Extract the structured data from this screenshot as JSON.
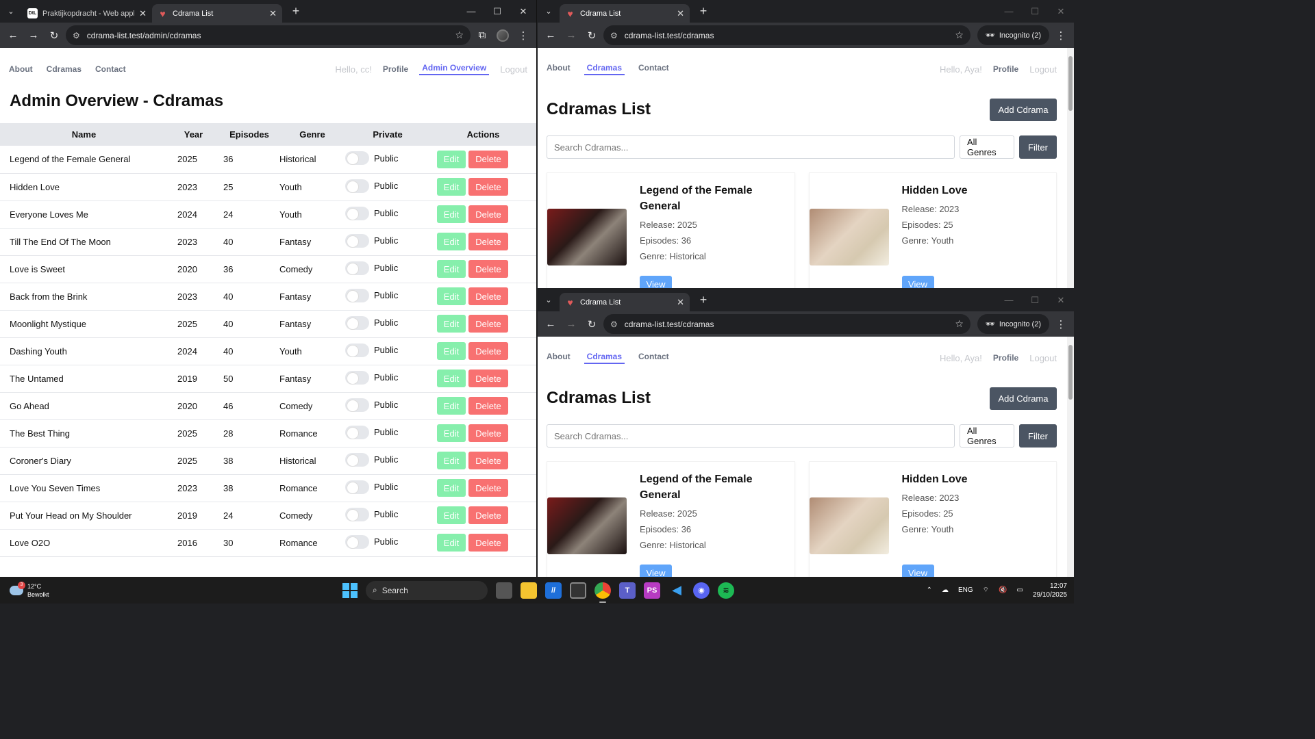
{
  "left_window": {
    "tabs": [
      {
        "title": "Praktijkopdracht - Web applicat",
        "favicon": "DtL"
      },
      {
        "title": "Cdrama List",
        "favicon": "heart-logo"
      }
    ],
    "url": "cdrama-list.test/admin/cdramas",
    "nav": {
      "links": [
        "About",
        "Cdramas",
        "Contact"
      ],
      "greeting": "Hello, cc!",
      "profile": "Profile",
      "active": "Admin Overview",
      "logout": "Logout"
    },
    "title": "Admin Overview - Cdramas",
    "columns": [
      "Name",
      "Year",
      "Episodes",
      "Genre",
      "Private",
      "Actions"
    ],
    "rows": [
      {
        "name": "Legend of the Female General",
        "year": "2025",
        "episodes": "36",
        "genre": "Historical",
        "private": "Public"
      },
      {
        "name": "Hidden Love",
        "year": "2023",
        "episodes": "25",
        "genre": "Youth",
        "private": "Public"
      },
      {
        "name": "Everyone Loves Me",
        "year": "2024",
        "episodes": "24",
        "genre": "Youth",
        "private": "Public"
      },
      {
        "name": "Till The End Of The Moon",
        "year": "2023",
        "episodes": "40",
        "genre": "Fantasy",
        "private": "Public"
      },
      {
        "name": "Love is Sweet",
        "year": "2020",
        "episodes": "36",
        "genre": "Comedy",
        "private": "Public"
      },
      {
        "name": "Back from the Brink",
        "year": "2023",
        "episodes": "40",
        "genre": "Fantasy",
        "private": "Public"
      },
      {
        "name": "Moonlight Mystique",
        "year": "2025",
        "episodes": "40",
        "genre": "Fantasy",
        "private": "Public"
      },
      {
        "name": "Dashing Youth",
        "year": "2024",
        "episodes": "40",
        "genre": "Youth",
        "private": "Public"
      },
      {
        "name": "The Untamed",
        "year": "2019",
        "episodes": "50",
        "genre": "Fantasy",
        "private": "Public"
      },
      {
        "name": "Go Ahead",
        "year": "2020",
        "episodes": "46",
        "genre": "Comedy",
        "private": "Public"
      },
      {
        "name": "The Best Thing",
        "year": "2025",
        "episodes": "28",
        "genre": "Romance",
        "private": "Public"
      },
      {
        "name": "Coroner's Diary",
        "year": "2025",
        "episodes": "38",
        "genre": "Historical",
        "private": "Public"
      },
      {
        "name": "Love You Seven Times",
        "year": "2023",
        "episodes": "38",
        "genre": "Romance",
        "private": "Public"
      },
      {
        "name": "Put Your Head on My Shoulder",
        "year": "2019",
        "episodes": "24",
        "genre": "Comedy",
        "private": "Public"
      },
      {
        "name": "Love O2O",
        "year": "2016",
        "episodes": "30",
        "genre": "Romance",
        "private": "Public"
      }
    ],
    "edit_label": "Edit",
    "delete_label": "Delete"
  },
  "right_window": {
    "tab_title": "Cdrama List",
    "url": "cdrama-list.test/cdramas",
    "incognito": "Incognito (2)",
    "nav": {
      "links": [
        "About",
        "Cdramas",
        "Contact"
      ],
      "greeting": "Hello, Aya!",
      "profile": "Profile",
      "logout": "Logout"
    },
    "title": "Cdramas List",
    "add_label": "Add Cdrama",
    "search_placeholder": "Search Cdramas...",
    "genre_select": "All Genres",
    "filter_label": "Filter",
    "view_label": "View",
    "cards": [
      {
        "title": "Legend of the Female General",
        "release": "Release: 2025",
        "episodes": "Episodes: 36",
        "genre": "Genre: Historical"
      },
      {
        "title": "Hidden Love",
        "release": "Release: 2023",
        "episodes": "Episodes: 25",
        "genre": "Genre: Youth"
      }
    ]
  },
  "taskbar": {
    "temp": "12°C",
    "weather": "Bewolkt",
    "badge": "3",
    "search": "Search",
    "lang": "ENG",
    "time": "12:07",
    "date": "29/10/2025"
  },
  "colors": {
    "accent": "#6366f1",
    "edit": "#86efac",
    "delete": "#f87171",
    "view": "#60a5fa",
    "dark_button": "#4b5563"
  }
}
